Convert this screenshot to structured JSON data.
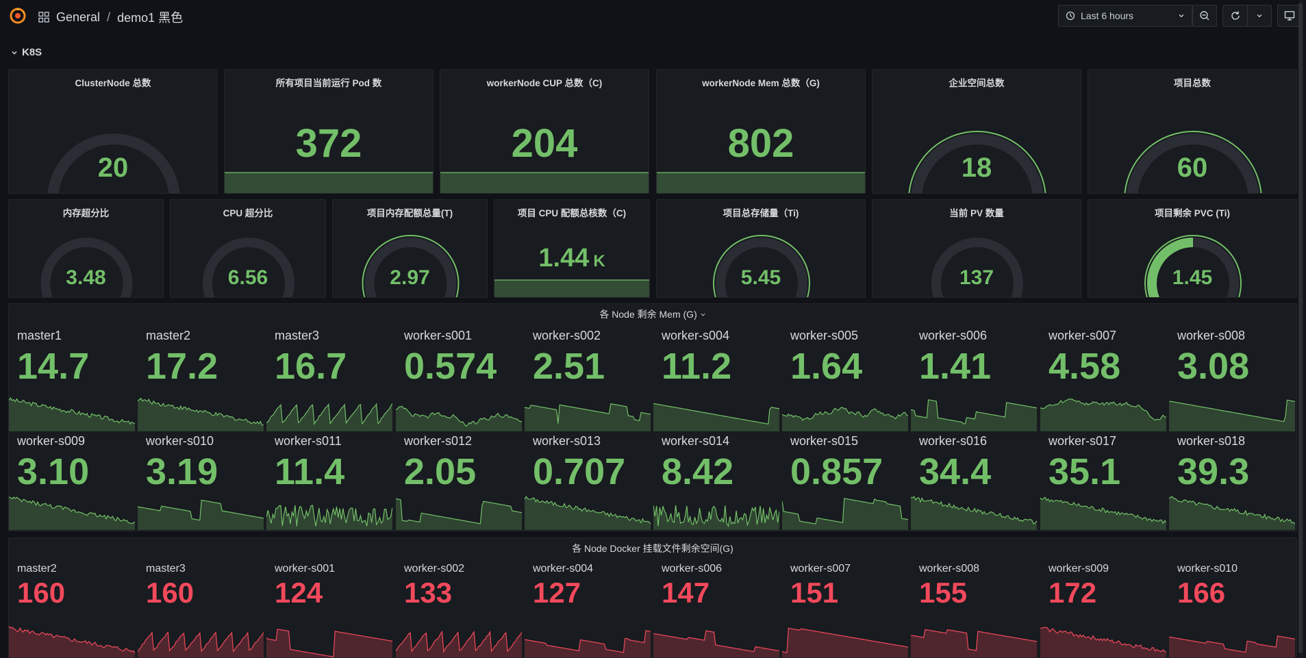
{
  "breadcrumb": {
    "folder": "General",
    "separator": "/",
    "dashboard": "demo1 黑色"
  },
  "toolbar": {
    "time_range": "Last 6 hours"
  },
  "row": {
    "title": "K8S"
  },
  "stats_top": [
    {
      "title": "ClusterNode 总数",
      "value": "20",
      "kind": "gauge",
      "fraction": 0.0
    },
    {
      "title": "所有项目当前运行 Pod 数",
      "value": "372",
      "kind": "stat"
    },
    {
      "title": "workerNode CUP 总数（C)",
      "value": "204",
      "kind": "stat"
    },
    {
      "title": "workerNode Mem 总数（G)",
      "value": "802",
      "kind": "stat"
    },
    {
      "title": "企业空间总数",
      "value": "18",
      "kind": "gauge",
      "fraction": 1.0
    },
    {
      "title": "项目总数",
      "value": "60",
      "kind": "gauge",
      "fraction": 1.0
    }
  ],
  "stats_second": [
    {
      "title": "内存超分比",
      "value": "3.48",
      "kind": "gauge",
      "fraction": 0.0
    },
    {
      "title": "CPU 超分比",
      "value": "6.56",
      "kind": "gauge",
      "fraction": 0.0
    },
    {
      "title": "项目内存配额总量(T)",
      "value": "2.97",
      "kind": "gauge",
      "fraction": 1.0
    },
    {
      "title": "项目 CPU 配额总核数（C)",
      "value": "1.44",
      "unit": "K",
      "kind": "stat"
    },
    {
      "title": "项目总存储量（Ti)",
      "value": "5.45",
      "kind": "gauge",
      "fraction": 1.0
    },
    {
      "title": "当前 PV 数量",
      "value": "137",
      "kind": "gauge",
      "fraction": 0.0
    },
    {
      "title": "项目剩余 PVC (Ti)",
      "value": "1.45",
      "kind": "gauge",
      "fraction": 0.5
    }
  ],
  "mem_panel": {
    "title": "各 Node 剩余 Mem (G)",
    "nodes": [
      {
        "name": "master1",
        "value": "14.7"
      },
      {
        "name": "master2",
        "value": "17.2"
      },
      {
        "name": "master3",
        "value": "16.7"
      },
      {
        "name": "worker-s001",
        "value": "0.574"
      },
      {
        "name": "worker-s002",
        "value": "2.51"
      },
      {
        "name": "worker-s004",
        "value": "11.2"
      },
      {
        "name": "worker-s005",
        "value": "1.64"
      },
      {
        "name": "worker-s006",
        "value": "1.41"
      },
      {
        "name": "worker-s007",
        "value": "4.58"
      },
      {
        "name": "worker-s008",
        "value": "3.08"
      },
      {
        "name": "worker-s009",
        "value": "3.10"
      },
      {
        "name": "worker-s010",
        "value": "3.19"
      },
      {
        "name": "worker-s011",
        "value": "11.4"
      },
      {
        "name": "worker-s012",
        "value": "2.05"
      },
      {
        "name": "worker-s013",
        "value": "0.707"
      },
      {
        "name": "worker-s014",
        "value": "8.42"
      },
      {
        "name": "worker-s015",
        "value": "0.857"
      },
      {
        "name": "worker-s016",
        "value": "34.4"
      },
      {
        "name": "worker-s017",
        "value": "35.1"
      },
      {
        "name": "worker-s018",
        "value": "39.3"
      }
    ]
  },
  "docker_panel": {
    "title": "各 Node Docker 挂载文件剩余空间(G)",
    "nodes": [
      {
        "name": "master2",
        "value": "160"
      },
      {
        "name": "master3",
        "value": "160"
      },
      {
        "name": "worker-s001",
        "value": "124"
      },
      {
        "name": "worker-s002",
        "value": "133"
      },
      {
        "name": "worker-s004",
        "value": "127"
      },
      {
        "name": "worker-s006",
        "value": "147"
      },
      {
        "name": "worker-s007",
        "value": "151"
      },
      {
        "name": "worker-s008",
        "value": "155"
      },
      {
        "name": "worker-s009",
        "value": "172"
      },
      {
        "name": "worker-s010",
        "value": "166"
      }
    ]
  },
  "colors": {
    "green": "#73bf69",
    "red": "#f2495c",
    "panel_bg": "#181b1f",
    "page_bg": "#111217"
  }
}
